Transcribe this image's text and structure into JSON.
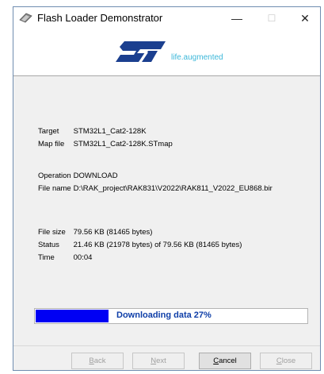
{
  "window": {
    "title": "Flash Loader Demonstrator",
    "app_icon": "flash-loader-icon",
    "minimize_glyph": "—",
    "maximize_glyph": "☐",
    "close_glyph": "✕"
  },
  "banner": {
    "logo": "st-logo",
    "tagline": "life.augmented",
    "brand_color": "#1b3f8f",
    "tagline_color": "#3bb7d9"
  },
  "info": {
    "target": {
      "label": "Target",
      "value": "STM32L1_Cat2-128K"
    },
    "map_file": {
      "label": "Map file",
      "value": "STM32L1_Cat2-128K.STmap"
    },
    "operation": {
      "label": "Operation",
      "value": "DOWNLOAD"
    },
    "file_name": {
      "label": "File name",
      "value": "D:\\RAK_project\\RAK831\\V2022\\RAK811_V2022_EU868.bir"
    },
    "file_size": {
      "label": "File size",
      "value": "79.56 KB (81465 bytes)"
    },
    "status": {
      "label": "Status",
      "value": "21.46 KB (21978 bytes) of 79.56 KB (81465 bytes)"
    },
    "time": {
      "label": "Time",
      "value": "00:04"
    }
  },
  "progress": {
    "text": "Downloading data 27%",
    "fraction": 0.27,
    "fill_color": "#0000f4",
    "text_color": "#0e3ea8"
  },
  "buttons": {
    "back": {
      "first": "B",
      "rest": "ack",
      "enabled": false
    },
    "next": {
      "first": "N",
      "rest": "ext",
      "enabled": false
    },
    "cancel": {
      "first": "C",
      "rest": "ancel",
      "enabled": true
    },
    "close": {
      "first": "C",
      "rest": "lose",
      "enabled": false
    }
  }
}
